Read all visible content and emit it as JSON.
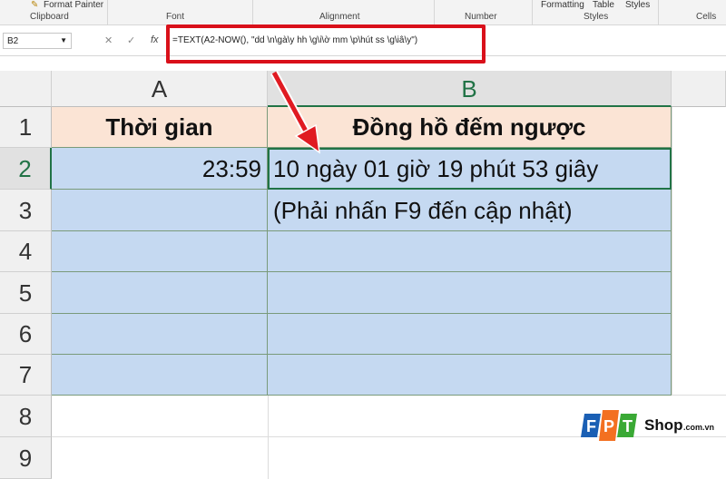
{
  "ribbon": {
    "format_painter": "Format Painter",
    "groups": [
      "Clipboard",
      "Font",
      "Alignment",
      "Number",
      "Styles",
      "Cells"
    ],
    "formatting": "Formatting",
    "table": "Table",
    "styles": "Styles"
  },
  "formula_bar": {
    "name_box": "B2",
    "fx": "fx",
    "formula": "=TEXT(A2-NOW(), \"dd \\n\\gà\\y hh \\g\\i\\ờ mm \\p\\hút ss \\g\\iâ\\y\")"
  },
  "columns": [
    "A",
    "B"
  ],
  "rows": [
    "1",
    "2",
    "3",
    "4",
    "5",
    "6",
    "7",
    "8",
    "9"
  ],
  "cells": {
    "A1": "Thời gian",
    "B1": "Đồng hồ đếm ngược",
    "A2": "23:59",
    "B2": "10 ngày 01 giờ 19 phút 53 giây",
    "B3": "(Phải nhấn F9 đến cập nhật)"
  },
  "logo": {
    "brand": "FPT",
    "shop": "Shop",
    ".com.vn": ".com.vn"
  },
  "colors": {
    "highlight": "#d9101a",
    "header_fill": "#fbe4d5",
    "data_fill": "#c5d9f1"
  }
}
